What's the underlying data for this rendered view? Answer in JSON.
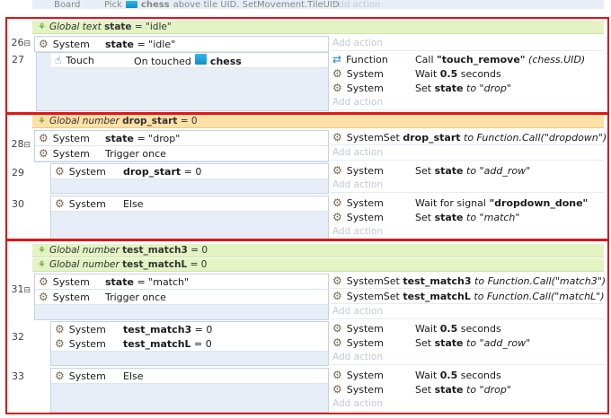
{
  "top_partial": {
    "object": "Board",
    "text": "Pick",
    "object2": "chess",
    "tail": "above tile UID. SetMovement.TileUID",
    "add_action": "Add action"
  },
  "blocks": [
    {
      "global_label": "Global text",
      "global_name": "state",
      "global_value": "= \"idle\"",
      "events": [
        {
          "line": "26",
          "conditions": [
            {
              "object": "System",
              "bold": "state",
              "text": " = \"idle\""
            }
          ],
          "actions": [],
          "add_action": "Add action"
        },
        {
          "line": "27",
          "conditions": [
            {
              "object": "Touch",
              "text": "On touched",
              "object2": "chess"
            }
          ],
          "actions": [
            {
              "object": "Function",
              "pre": "Call ",
              "bold": "\"touch_remove\"",
              "post": " (chess.UID)"
            },
            {
              "object": "System",
              "pre": "Wait ",
              "bold": "0.5",
              "post": " seconds"
            },
            {
              "object": "System",
              "pre": "Set ",
              "bold": "state",
              "post": " to \"drop\""
            }
          ],
          "add_action": "Add action"
        }
      ]
    },
    {
      "global_label": "Global number",
      "global_name": "drop_start",
      "global_value": "= 0",
      "events": [
        {
          "line": "28",
          "conditions": [
            {
              "object": "System",
              "bold": "state",
              "text": " = \"drop\""
            },
            {
              "object": "System",
              "text": "Trigger once"
            }
          ],
          "actions": [
            {
              "object": "System",
              "pre": "Set ",
              "bold": "drop_start",
              "post": " to Function.Call(\"dropdown\")"
            }
          ],
          "add_action": "Add action"
        },
        {
          "line": "29",
          "conditions": [
            {
              "object": "System",
              "bold": "drop_start",
              "text": " = 0"
            }
          ],
          "actions": [
            {
              "object": "System",
              "pre": "Set ",
              "bold": "state",
              "post": " to \"add_row\""
            }
          ],
          "add_action": "Add action"
        },
        {
          "line": "30",
          "conditions": [
            {
              "object": "System",
              "text": "Else"
            }
          ],
          "actions": [
            {
              "object": "System",
              "pre": "Wait for signal ",
              "bold": "\"dropdown_done\"",
              "post": ""
            },
            {
              "object": "System",
              "pre": "Set ",
              "bold": "state",
              "post": " to \"match\""
            }
          ],
          "add_action": "Add action"
        }
      ]
    },
    {
      "global_label": "Global number",
      "global_name": "test_match3",
      "global_value": "= 0",
      "global2_label": "Global number",
      "global2_name": "test_matchL",
      "global2_value": "= 0",
      "events": [
        {
          "line": "31",
          "conditions": [
            {
              "object": "System",
              "bold": "state",
              "text": " = \"match\""
            },
            {
              "object": "System",
              "text": "Trigger once"
            }
          ],
          "actions": [
            {
              "object": "System",
              "pre": "Set ",
              "bold": "test_match3",
              "post": " to Function.Call(\"match3\")"
            },
            {
              "object": "System",
              "pre": "Set ",
              "bold": "test_matchL",
              "post": " to Function.Call(\"matchL\")"
            }
          ],
          "add_action": "Add action"
        },
        {
          "line": "32",
          "conditions": [
            {
              "object": "System",
              "bold": "test_match3",
              "text": " = 0"
            },
            {
              "object": "System",
              "bold": "test_matchL",
              "text": " = 0"
            }
          ],
          "actions": [
            {
              "object": "System",
              "pre": "Wait ",
              "bold": "0.5",
              "post": " seconds"
            },
            {
              "object": "System",
              "pre": "Set ",
              "bold": "state",
              "post": " to \"add_row\""
            }
          ],
          "add_action": "Add action"
        },
        {
          "line": "33",
          "conditions": [
            {
              "object": "System",
              "text": "Else"
            }
          ],
          "actions": [
            {
              "object": "System",
              "pre": "Wait ",
              "bold": "0.5",
              "post": " seconds"
            },
            {
              "object": "System",
              "pre": "Set ",
              "bold": "state",
              "post": " to \"drop\""
            }
          ],
          "add_action": "Add action"
        }
      ]
    }
  ],
  "colors": {
    "highlight_border": "#e01515",
    "global_text_bg": "#e3f3c3",
    "global_number_orange_bg": "#ffe0a6"
  }
}
